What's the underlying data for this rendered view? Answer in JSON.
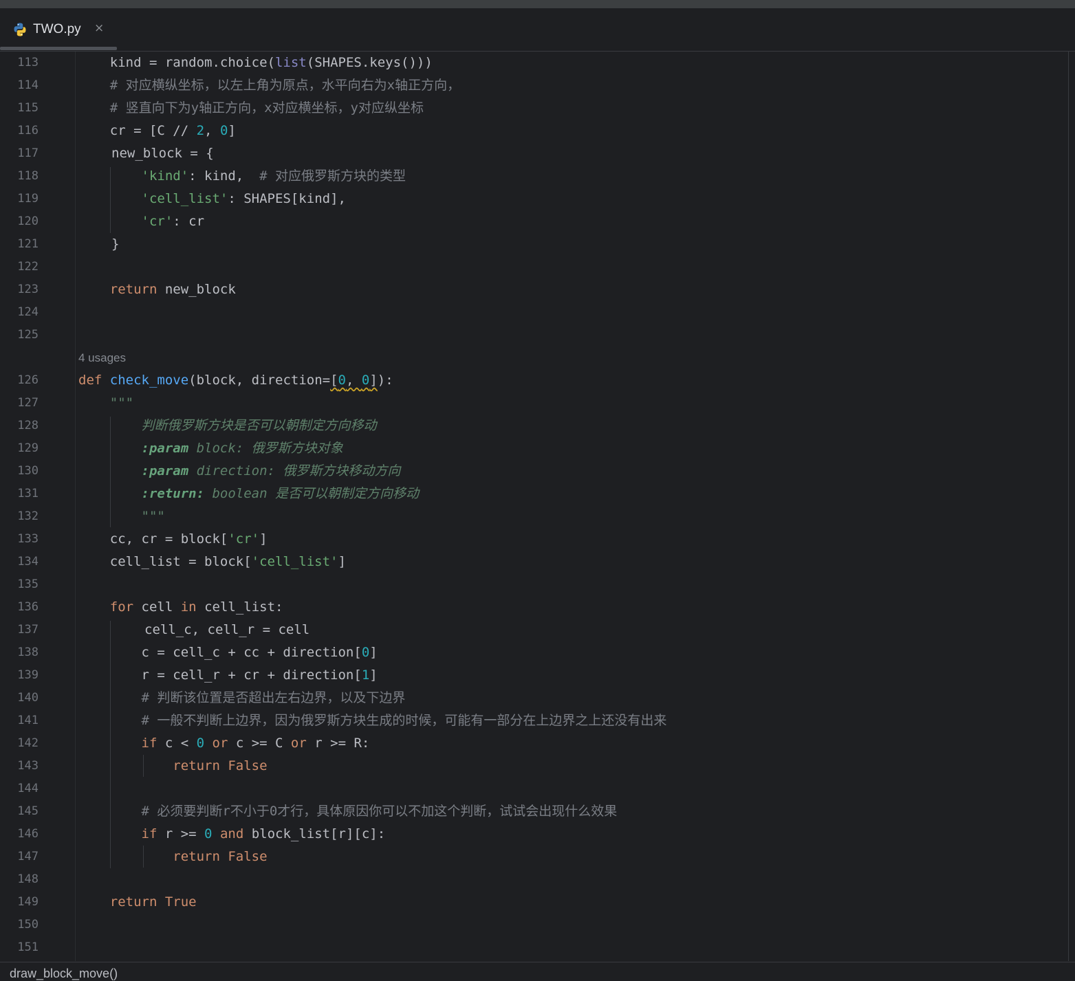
{
  "window": {
    "tab": {
      "title": "TWO.py",
      "close_glyph": "×",
      "icon": "python-icon"
    }
  },
  "editor": {
    "usages_hint": "4 usages",
    "lines": [
      {
        "no": "113",
        "code": "kind = random.choice(list(SHAPES.keys()))"
      },
      {
        "no": "114",
        "code": "# 对应横纵坐标，以左上角为原点，水平向右为x轴正方向，"
      },
      {
        "no": "115",
        "code": "# 竖直向下为y轴正方向，x对应横坐标，y对应纵坐标"
      },
      {
        "no": "116",
        "code": "cr = [C // 2, 0]"
      },
      {
        "no": "117",
        "code": "new_block = {"
      },
      {
        "no": "118",
        "code": "'kind': kind,  # 对应俄罗斯方块的类型"
      },
      {
        "no": "119",
        "code": "'cell_list': SHAPES[kind],"
      },
      {
        "no": "120",
        "code": "'cr': cr"
      },
      {
        "no": "121",
        "code": "}"
      },
      {
        "no": "122",
        "code": ""
      },
      {
        "no": "123",
        "code": "return new_block"
      },
      {
        "no": "124",
        "code": ""
      },
      {
        "no": "125",
        "code": ""
      },
      {
        "no": "126",
        "code": "def check_move(block, direction=[0, 0]):"
      },
      {
        "no": "127",
        "code": "\"\"\""
      },
      {
        "no": "128",
        "code": "判断俄罗斯方块是否可以朝制定方向移动"
      },
      {
        "no": "129",
        "code": ":param block: 俄罗斯方块对象"
      },
      {
        "no": "130",
        "code": ":param direction: 俄罗斯方块移动方向"
      },
      {
        "no": "131",
        "code": ":return: boolean 是否可以朝制定方向移动"
      },
      {
        "no": "132",
        "code": "\"\"\""
      },
      {
        "no": "133",
        "code": "cc, cr = block['cr']"
      },
      {
        "no": "134",
        "code": "cell_list = block['cell_list']"
      },
      {
        "no": "135",
        "code": ""
      },
      {
        "no": "136",
        "code": "for cell in cell_list:"
      },
      {
        "no": "137",
        "code": "cell_c, cell_r = cell"
      },
      {
        "no": "138",
        "code": "c = cell_c + cc + direction[0]"
      },
      {
        "no": "139",
        "code": "r = cell_r + cr + direction[1]"
      },
      {
        "no": "140",
        "code": "# 判断该位置是否超出左右边界，以及下边界"
      },
      {
        "no": "141",
        "code": "# 一般不判断上边界，因为俄罗斯方块生成的时候，可能有一部分在上边界之上还没有出来"
      },
      {
        "no": "142",
        "code": "if c < 0 or c >= C or r >= R:"
      },
      {
        "no": "143",
        "code": "return False"
      },
      {
        "no": "144",
        "code": ""
      },
      {
        "no": "145",
        "code": "# 必须要判断r不小于0才行，具体原因你可以不加这个判断，试试会出现什么效果"
      },
      {
        "no": "146",
        "code": "if r >= 0 and block_list[r][c]:"
      },
      {
        "no": "147",
        "code": "return False"
      },
      {
        "no": "148",
        "code": ""
      },
      {
        "no": "149",
        "code": "return True"
      },
      {
        "no": "150",
        "code": ""
      },
      {
        "no": "151",
        "code": ""
      }
    ]
  },
  "statusbar": {
    "breadcrumb": "draw_block_move()"
  },
  "theme": {
    "background": "#1e1f22",
    "keyword": "#cf8e6d",
    "function": "#56a8f5",
    "string": "#6aab73",
    "number": "#2aacb8",
    "comment": "#7a7e85",
    "docstring": "#5f826b"
  }
}
